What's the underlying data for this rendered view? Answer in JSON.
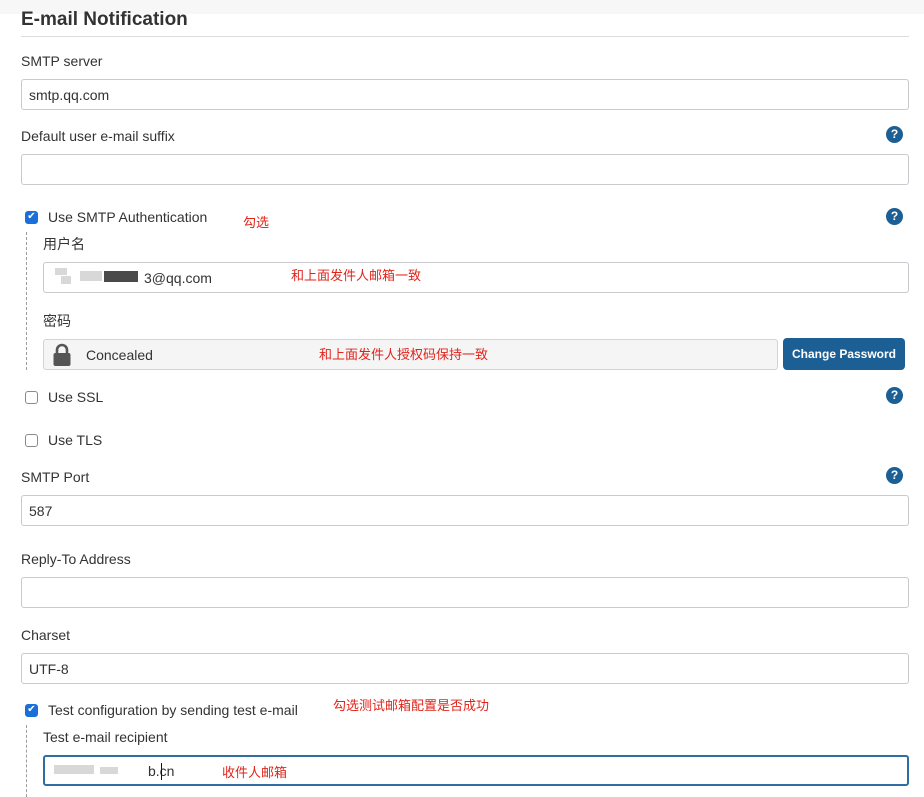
{
  "section": {
    "title": "E-mail Notification"
  },
  "smtp_server": {
    "label": "SMTP server",
    "value": "smtp.qq.com"
  },
  "email_suffix": {
    "label": "Default user e-mail suffix",
    "value": ""
  },
  "smtp_auth": {
    "label": "Use SMTP Authentication",
    "checked": true,
    "username_label": "用户名",
    "username_value": "3@qq.com",
    "password_label": "密码",
    "password_text": "Concealed",
    "change_password_label": "Change Password"
  },
  "use_ssl": {
    "label": "Use SSL",
    "checked": false
  },
  "use_tls": {
    "label": "Use TLS",
    "checked": false
  },
  "smtp_port": {
    "label": "SMTP Port",
    "value": "587"
  },
  "reply_to": {
    "label": "Reply-To Address",
    "value": ""
  },
  "charset": {
    "label": "Charset",
    "value": "UTF-8"
  },
  "test_config": {
    "label": "Test configuration by sending test e-mail",
    "checked": true,
    "recipient_label": "Test e-mail recipient",
    "recipient_value": "b.cn"
  },
  "help": {
    "icon_text": "?"
  },
  "annotations": {
    "check_auth": "勾选",
    "same_sender": "和上面发件人邮箱一致",
    "same_auth_code": "和上面发件人授权码保持一致",
    "check_test": "勾选测试邮箱配置是否成功",
    "recipient": "收件人邮箱"
  },
  "colors": {
    "accent": "#1c5f95",
    "checkbox": "#1a6fd8",
    "annotation": "#e0241a",
    "focus": "#2e6ea3"
  },
  "icons": {
    "help": "question-circle-icon",
    "lock": "padlock-icon",
    "check": "checkmark-icon"
  }
}
